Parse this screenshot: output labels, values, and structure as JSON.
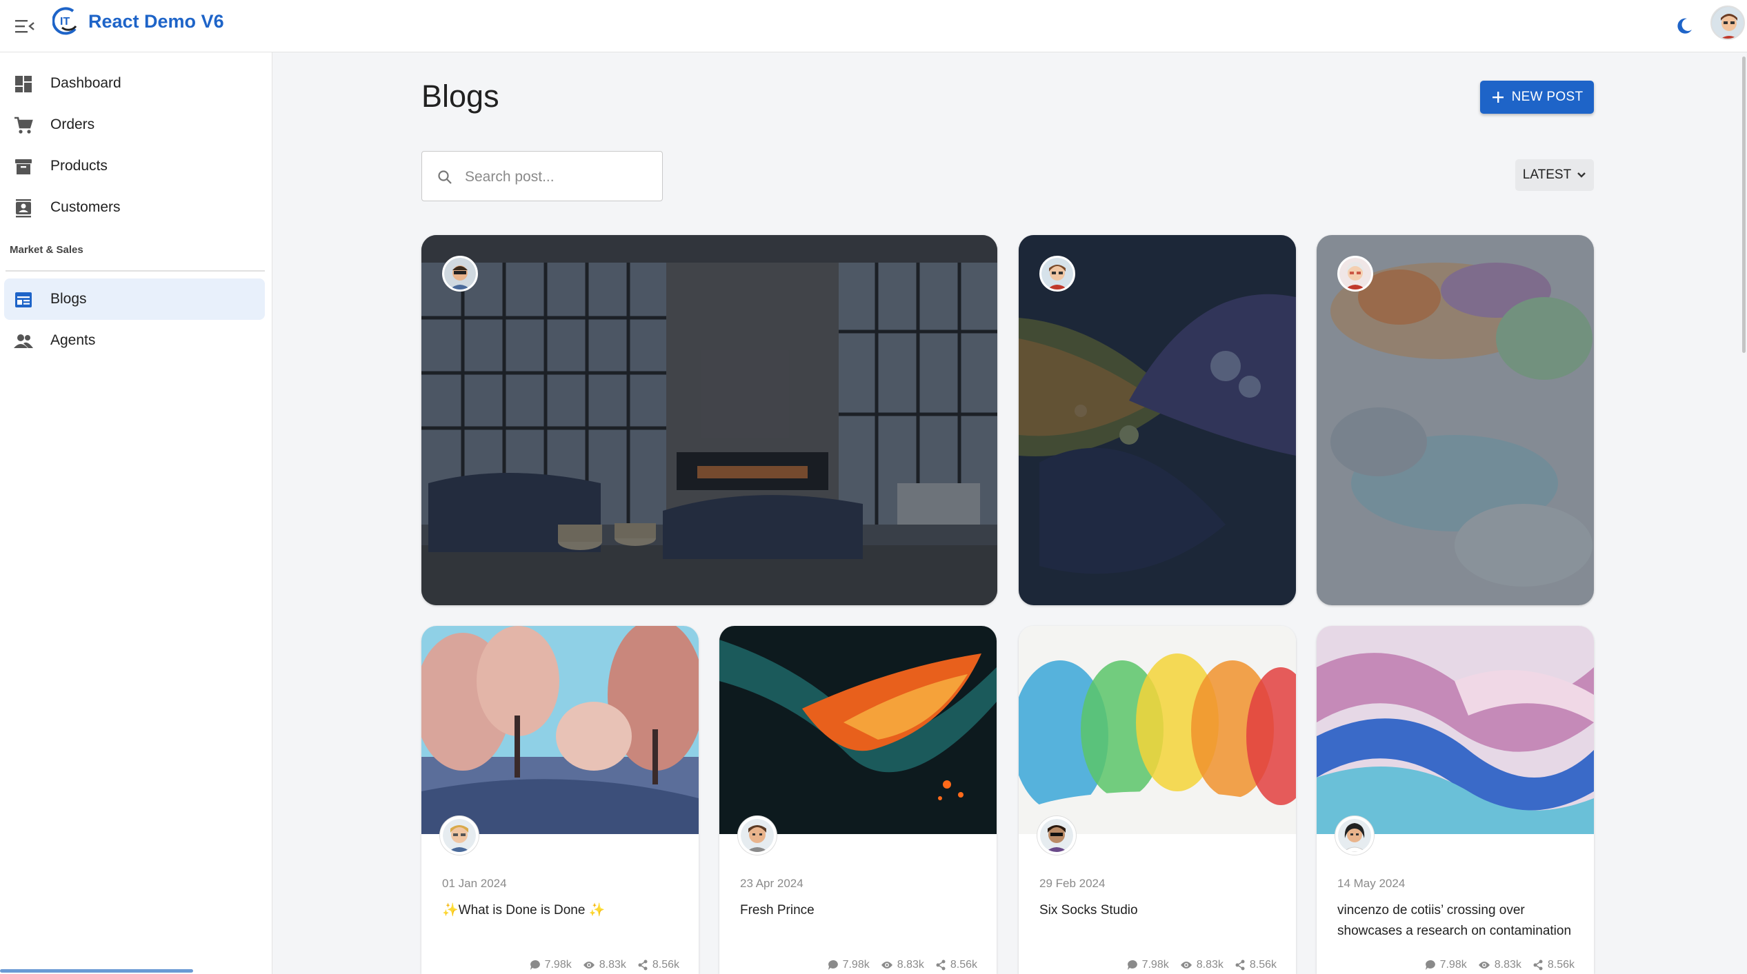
{
  "app": {
    "title": "React Demo V6"
  },
  "sidebar": {
    "items": [
      {
        "label": "Dashboard",
        "icon": "dashboard-icon"
      },
      {
        "label": "Orders",
        "icon": "cart-icon"
      },
      {
        "label": "Products",
        "icon": "archive-icon"
      },
      {
        "label": "Customers",
        "icon": "contact-icon"
      }
    ],
    "section_label": "Market & Sales",
    "section_items": [
      {
        "label": "Blogs",
        "icon": "blog-icon",
        "active": true
      },
      {
        "label": "Agents",
        "icon": "people-icon"
      }
    ]
  },
  "page": {
    "title": "Blogs",
    "new_post_label": "NEW POST",
    "search_placeholder": "Search post...",
    "sort_label": "LATEST"
  },
  "featured_posts": [
    {
      "image": "living-room-photo",
      "author_avatar": "avatar-sunglasses"
    },
    {
      "image": "leaf-droplets-photo",
      "author_avatar": "avatar-boy"
    },
    {
      "image": "watercolor-wash-photo",
      "author_avatar": "avatar-grandma"
    }
  ],
  "posts": [
    {
      "date": "01 Jan 2024",
      "title": "✨What is Done is Done ✨",
      "comments": "7.98k",
      "views": "8.83k",
      "shares": "8.56k"
    },
    {
      "date": "23 Apr 2024",
      "title": "Fresh Prince",
      "comments": "7.98k",
      "views": "8.83k",
      "shares": "8.56k"
    },
    {
      "date": "29 Feb 2024",
      "title": "Six Socks Studio",
      "comments": "7.98k",
      "views": "8.83k",
      "shares": "8.56k"
    },
    {
      "date": "14 May 2024",
      "title": "vincenzo de cotiis’ crossing over showcases a research on contamination",
      "comments": "7.98k",
      "views": "8.83k",
      "shares": "8.56k"
    }
  ],
  "colors": {
    "accent": "#1e64c8",
    "active_bg": "#e8f0fb",
    "background": "#f4f5f7"
  }
}
